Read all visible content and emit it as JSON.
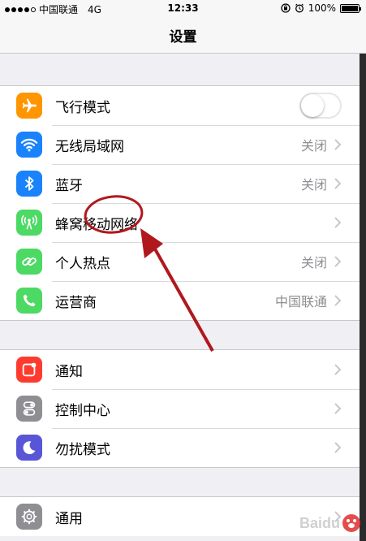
{
  "status_bar": {
    "carrier": "中国联通",
    "network": "4G",
    "time": "12:33",
    "battery": "100%"
  },
  "nav": {
    "title": "设置"
  },
  "groups": [
    {
      "rows": [
        {
          "label": "飞行模式",
          "icon": "airplane-icon",
          "icon_color": "#ff9500",
          "control": "toggle",
          "toggle_on": false
        },
        {
          "label": "无线局域网",
          "icon": "wifi-icon",
          "icon_color": "#1a82fb",
          "value": "关闭"
        },
        {
          "label": "蓝牙",
          "icon": "bluetooth-icon",
          "icon_color": "#1a82fb",
          "value": "关闭"
        },
        {
          "label": "蜂窝移动网络",
          "icon": "cellular-icon",
          "icon_color": "#4cd964",
          "value": ""
        },
        {
          "label": "个人热点",
          "icon": "hotspot-icon",
          "icon_color": "#4cd964",
          "value": "关闭"
        },
        {
          "label": "运营商",
          "icon": "phone-icon",
          "icon_color": "#4cd964",
          "value": "中国联通"
        }
      ]
    },
    {
      "rows": [
        {
          "label": "通知",
          "icon": "notification-icon",
          "icon_color": "#ff3b30",
          "value": ""
        },
        {
          "label": "控制中心",
          "icon": "control-center-icon",
          "icon_color": "#8e8e93",
          "value": ""
        },
        {
          "label": "勿扰模式",
          "icon": "moon-icon",
          "icon_color": "#5856d6",
          "value": ""
        }
      ]
    },
    {
      "rows": [
        {
          "label": "通用",
          "icon": "gear-icon",
          "icon_color": "#8e8e93",
          "value": ""
        }
      ]
    }
  ],
  "annotation_color": "#b0181e",
  "watermark": {
    "text": "Baidu"
  }
}
